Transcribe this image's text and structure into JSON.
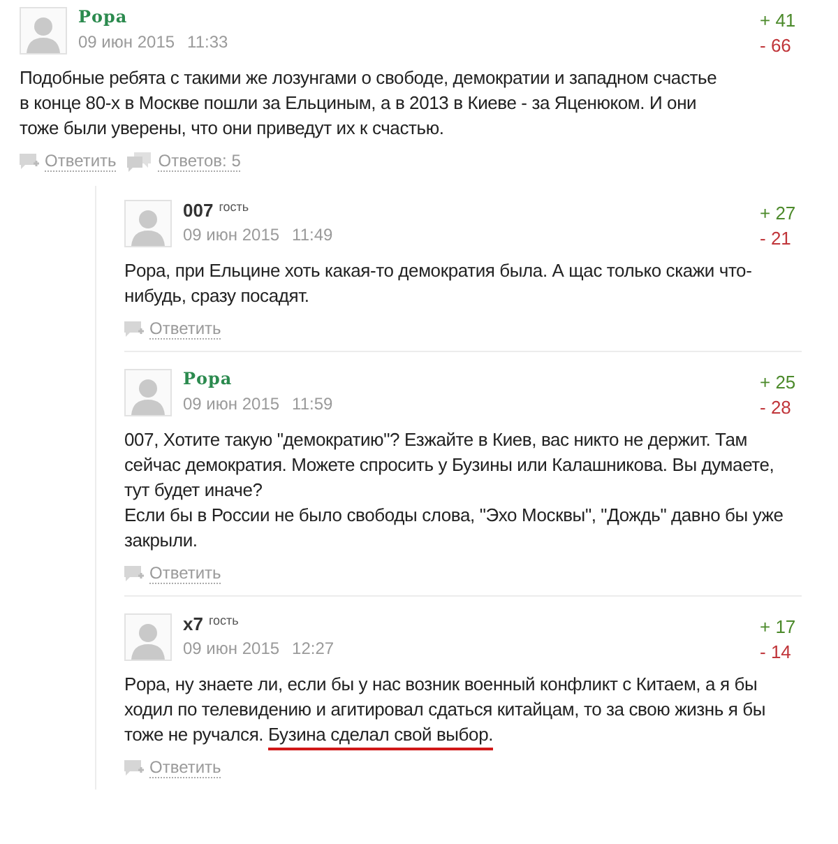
{
  "comments": [
    {
      "author": "Pора",
      "kind": "member",
      "date": "09 июн 2015",
      "time": "11:33",
      "up": "+ 41",
      "down": "- 66",
      "text": "Подобные ребята с такими же лозунгами о свободе, демократии и западном счастье в конце 80-х в Москве пошли за Ельциным, а в 2013 в Киеве - за Яценюком. И они тоже были уверены, что они приведут их к счастью.",
      "reply": "Ответить",
      "replies_link": "Ответов: 5",
      "children": [
        {
          "author": "007",
          "kind": "guest",
          "badge": "гость",
          "date": "09 июн 2015",
          "time": "11:49",
          "up": "+ 27",
          "down": "- 21",
          "text": "Pора, при Ельцине хоть какая-то демократия была. А щас только скажи что-нибудь, сразу посадят.",
          "reply": "Ответить"
        },
        {
          "author": "Pора",
          "kind": "member",
          "date": "09 июн 2015",
          "time": "11:59",
          "up": "+ 25",
          "down": "- 28",
          "text": "007, Хотите такую \"демократию\"? Езжайте в Киев, вас никто не держит. Там сейчас демократия. Можете спросить у Бузины или Калашникова. Вы думаете, тут будет иначе?\nЕсли бы в России не было свободы слова, \"Эхо Москвы\", \"Дождь\" давно бы уже закрыли.",
          "reply": "Ответить"
        },
        {
          "author": "x7",
          "kind": "guest",
          "badge": "гость",
          "date": "09 июн 2015",
          "time": "12:27",
          "up": "+ 17",
          "down": "- 14",
          "text": "Pора, ну знаете ли, если бы у нас возник военный конфликт с Китаем, а я бы ходил по телевидению и агитировал сдаться китайцам, то за свою жизнь я бы тоже не ручался.",
          "marked_text": "Бузина сделал свой выбор.",
          "reply": "Ответить"
        }
      ]
    }
  ]
}
